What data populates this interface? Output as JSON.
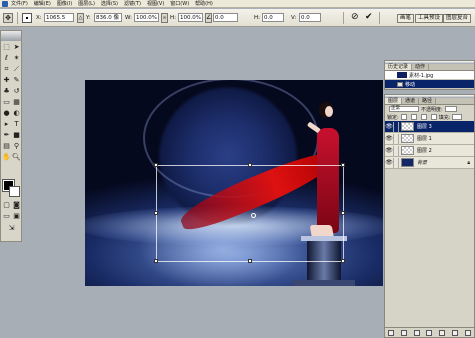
{
  "menu": {
    "items": [
      "文件(F)",
      "编辑(E)",
      "图像(I)",
      "图层(L)",
      "选择(S)",
      "滤镜(T)",
      "视图(V)",
      "窗口(W)",
      "帮助(H)"
    ]
  },
  "options": {
    "x_label": "X:",
    "x_value": "1065.5",
    "y_label": "Y:",
    "y_value": "836.0 像",
    "w_label": "W:",
    "w_value": "100.0%",
    "h_label": "H:",
    "h_value": "100.0%",
    "angle_value": "0.0",
    "hskew_label": "H:",
    "hskew_value": "0.0",
    "vskew_label": "V:",
    "vskew_value": "0.0",
    "workspace_buttons": [
      "画笔",
      "工具预设",
      "图层复合"
    ]
  },
  "history": {
    "tabs": [
      "历史记录",
      "动作"
    ],
    "snapshot_label": "素材-1.jpg",
    "step_label": "移动"
  },
  "layers": {
    "tabs": [
      "图层",
      "通道",
      "路径"
    ],
    "blend_mode": "正常",
    "opacity_label": "不透明度:",
    "lock_label": "锁定:",
    "fill_label": "填充:",
    "items": [
      {
        "name": "图层 3",
        "selected": true
      },
      {
        "name": "图层 1",
        "selected": false
      },
      {
        "name": "图层 2",
        "selected": false
      },
      {
        "name": "背景",
        "selected": false
      }
    ]
  }
}
